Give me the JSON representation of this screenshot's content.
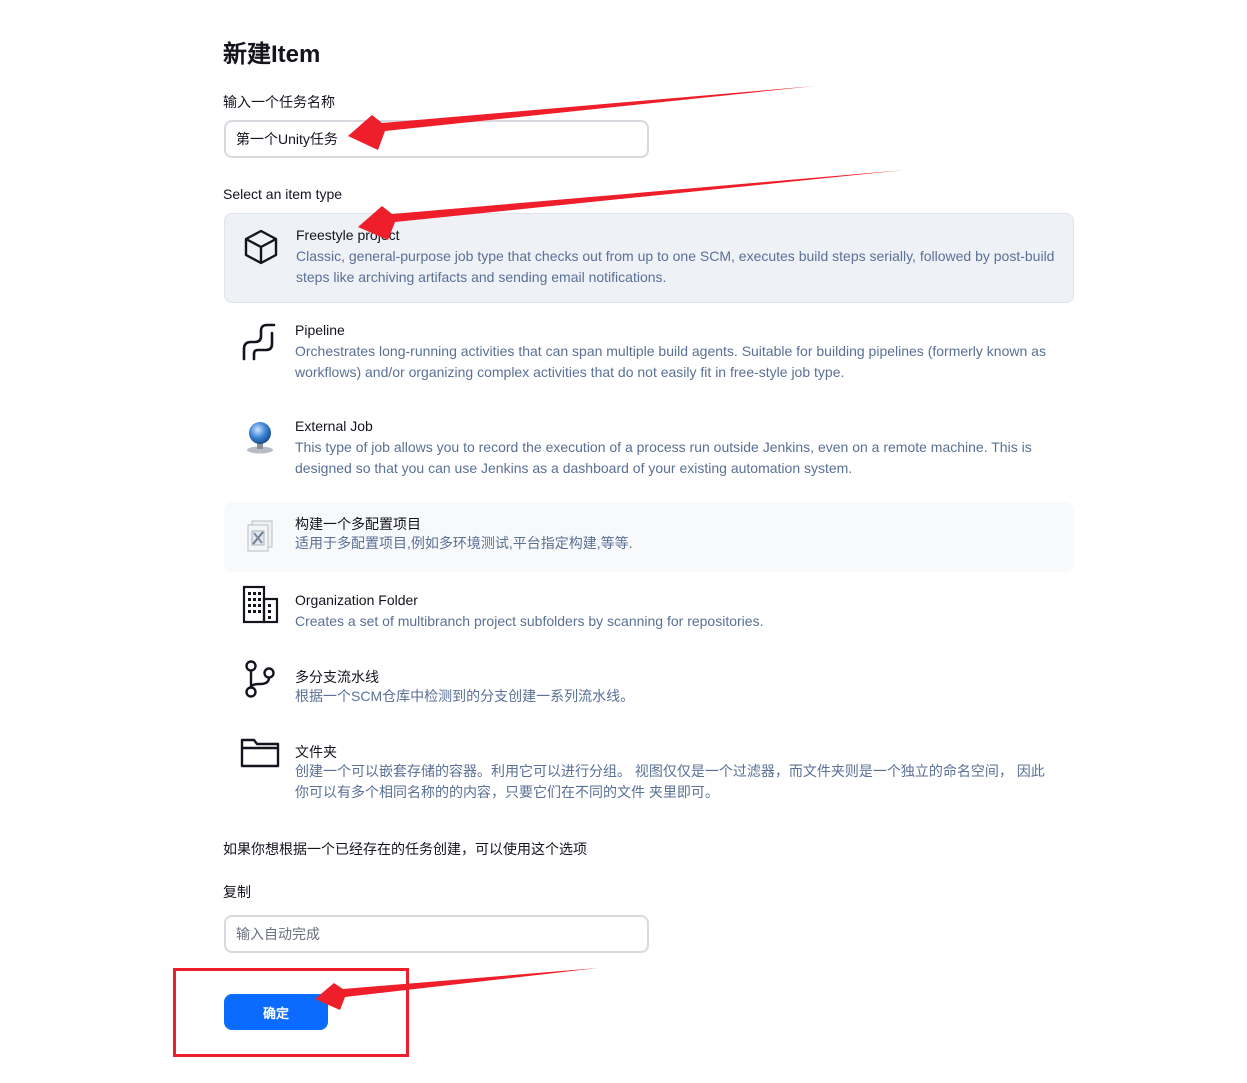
{
  "page": {
    "title": "新建Item"
  },
  "name_field": {
    "label": "输入一个任务名称",
    "value": "第一个Unity任务"
  },
  "item_type": {
    "label": "Select an item type",
    "items": [
      {
        "title": "Freestyle project",
        "icon": "freestyle-cube-icon",
        "description": "Classic, general-purpose job type that checks out from up to one SCM, executes build steps serially, followed by post-build steps like archiving artifacts and sending email notifications.",
        "selected": true
      },
      {
        "title": "Pipeline",
        "icon": "pipeline-icon",
        "description": "Orchestrates long-running activities that can span multiple build agents. Suitable for building pipelines (formerly known as workflows) and/or organizing complex activities that do not easily fit in free-style job type."
      },
      {
        "title": "External Job",
        "icon": "globe-icon",
        "description": "This type of job allows you to record the execution of a process run outside Jenkins, even on a remote machine. This is designed so that you can use Jenkins as a dashboard of your existing automation system."
      },
      {
        "title": "构建一个多配置项目",
        "icon": "multi-config-icon",
        "description": "适用于多配置项目,例如多环境测试,平台指定构建,等等."
      },
      {
        "title": "Organization Folder",
        "icon": "organization-building-icon",
        "description": "Creates a set of multibranch project subfolders by scanning for repositories."
      },
      {
        "title": "多分支流水线",
        "icon": "branch-icon",
        "description": "根据一个SCM仓库中检测到的分支创建一系列流水线。"
      },
      {
        "title": "文件夹",
        "icon": "folder-icon",
        "description": "创建一个可以嵌套存储的容器。利用它可以进行分组。 视图仅仅是一个过滤器，而文件夹则是一个独立的命名空间， 因此你可以有多个相同名称的的内容，只要它们在不同的文件 夹里即可。"
      }
    ]
  },
  "copy_section": {
    "hint": "如果你想根据一个已经存在的任务创建，可以使用这个选项",
    "label": "复制",
    "placeholder": "输入自动完成"
  },
  "submit": {
    "label": "确定"
  },
  "colors": {
    "accent": "#0b6bff",
    "annotation": "#ee1f2a",
    "description": "#5a7096"
  }
}
